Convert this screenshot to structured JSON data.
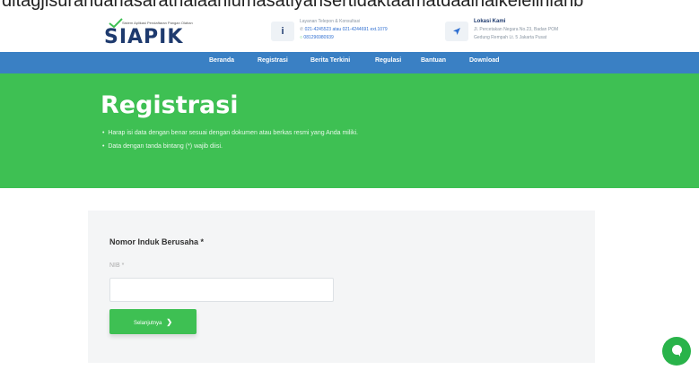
{
  "top_strip": {
    "text": "ditagjisuranuanasaratnalaaniumasatiyansertidaktaamatdaalnaikelelinlanb"
  },
  "header": {
    "logo": {
      "tagline": "Sistem Aplikasi Pendaftaran Pangan Olahan",
      "name": "SIAPIK"
    },
    "contact": {
      "icon": "info-icon",
      "title": "Layanan Telepon & Konsultasi",
      "phone": "021-4245523 atau 021-4244691 ext.1079",
      "whatsapp": "081296980939"
    },
    "location": {
      "icon": "location-arrow-icon",
      "title": "Lokasi Kami",
      "line1": "Jl. Percetakan Negara No.23, Badan POM",
      "line2": "Gedung Rempah Lt. 5 Jakarta Pusat"
    }
  },
  "nav": {
    "items": [
      "Beranda",
      "Registrasi",
      "Berita Terkini",
      "Regulasi",
      "Bantuan",
      "Download"
    ]
  },
  "hero": {
    "title": "Registrasi",
    "notes": [
      "Harap isi data dengan benar sesuai dengan dokumen atau berkas resmi yang Anda miliki.",
      "Data dengan tanda bintang (*) wajib diisi."
    ]
  },
  "form": {
    "title": "Nomor Induk Berusaha *",
    "label": "NIB *",
    "value": "",
    "button_label": "Selanjutnya",
    "button_icon": "chevron-right-icon"
  },
  "chat": {
    "icon": "chat-bubble-icon"
  },
  "colors": {
    "nav": "#3a80c4",
    "hero": "#3ec053",
    "brand": "#1e3a6e",
    "card": "#f4f5f6"
  }
}
